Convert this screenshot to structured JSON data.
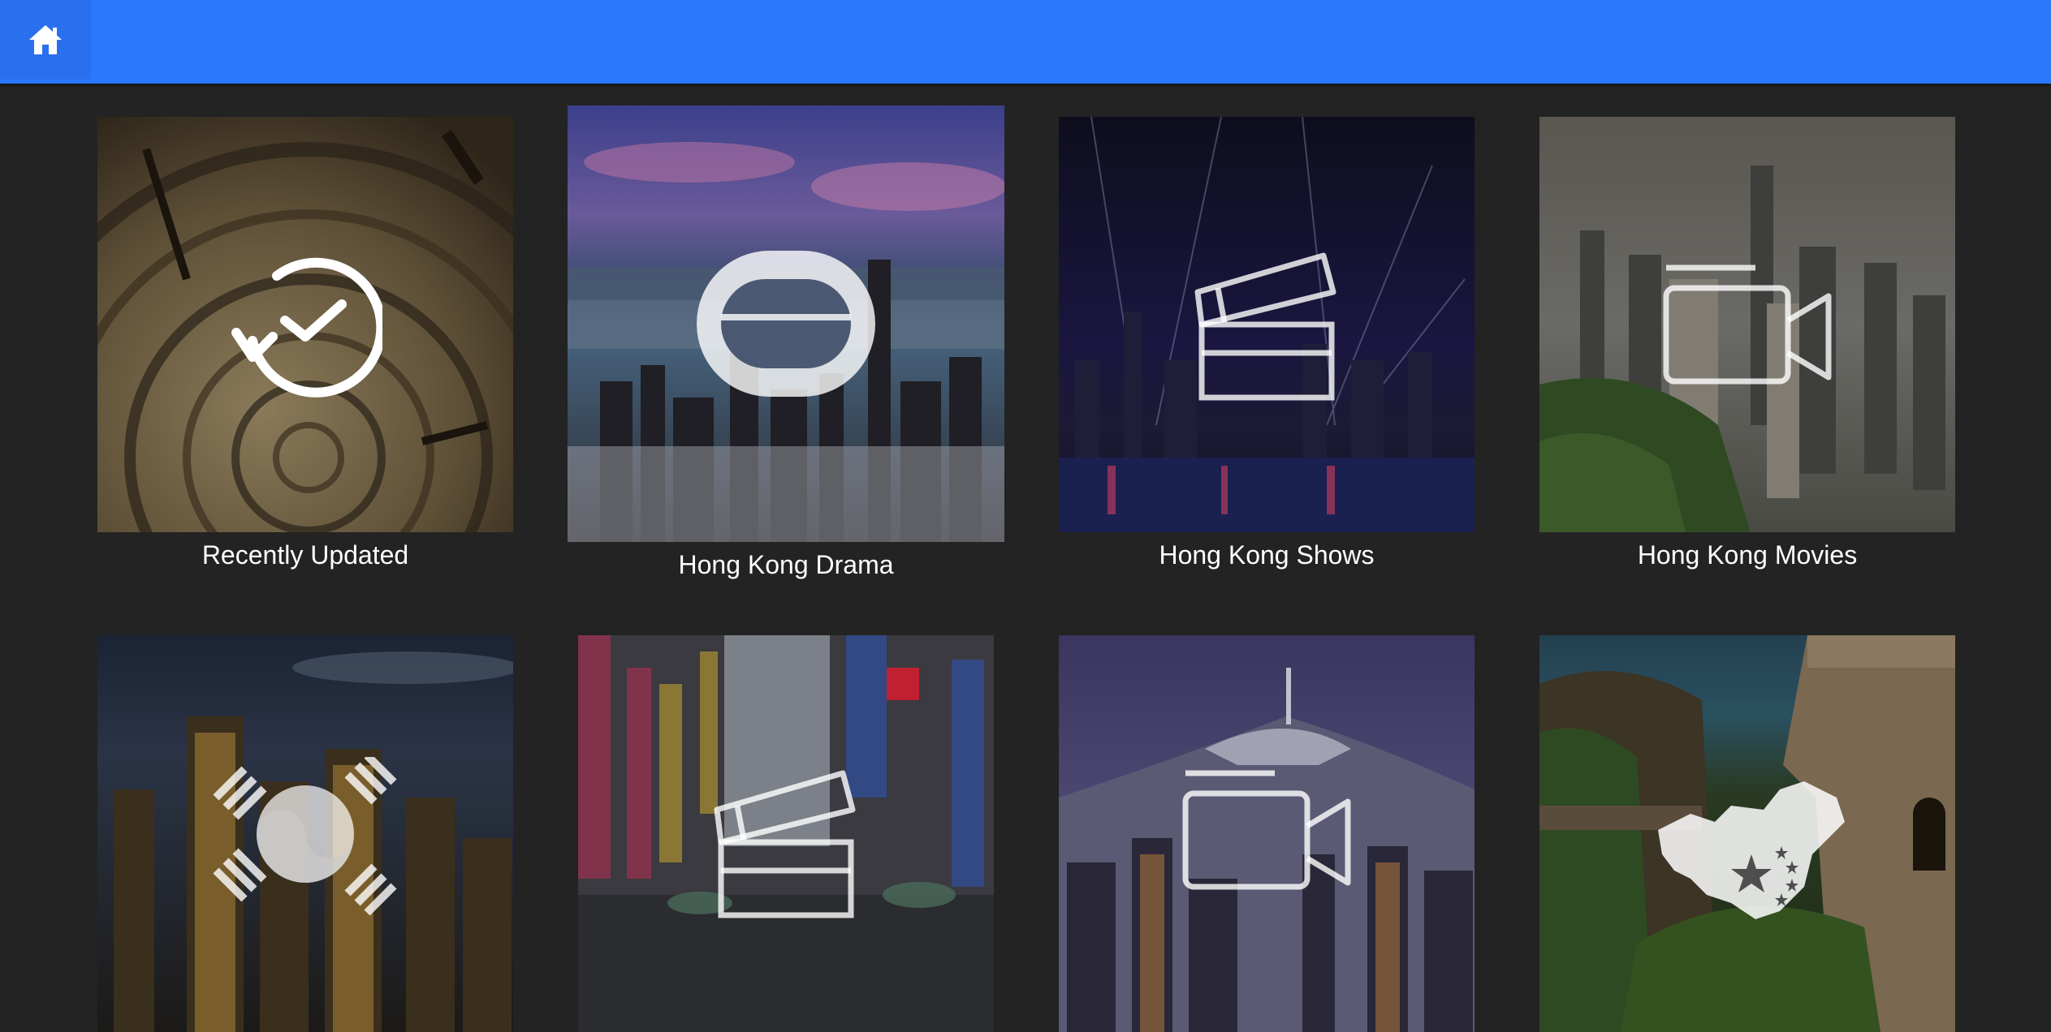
{
  "header": {
    "home_icon": "home-icon",
    "bar_color": "#2b78fc"
  },
  "tiles": [
    {
      "label": "Recently Updated",
      "icon": "recent-update-icon"
    },
    {
      "label": "Hong Kong Drama",
      "icon": "tv-drama-icon"
    },
    {
      "label": "Hong Kong Shows",
      "icon": "clapperboard-icon"
    },
    {
      "label": "Hong Kong Movies",
      "icon": "video-camera-icon"
    },
    {
      "label": "",
      "icon": "korea-flag-icon"
    },
    {
      "label": "",
      "icon": "clapperboard-icon"
    },
    {
      "label": "",
      "icon": "video-camera-icon"
    },
    {
      "label": "",
      "icon": "china-map-icon"
    }
  ]
}
